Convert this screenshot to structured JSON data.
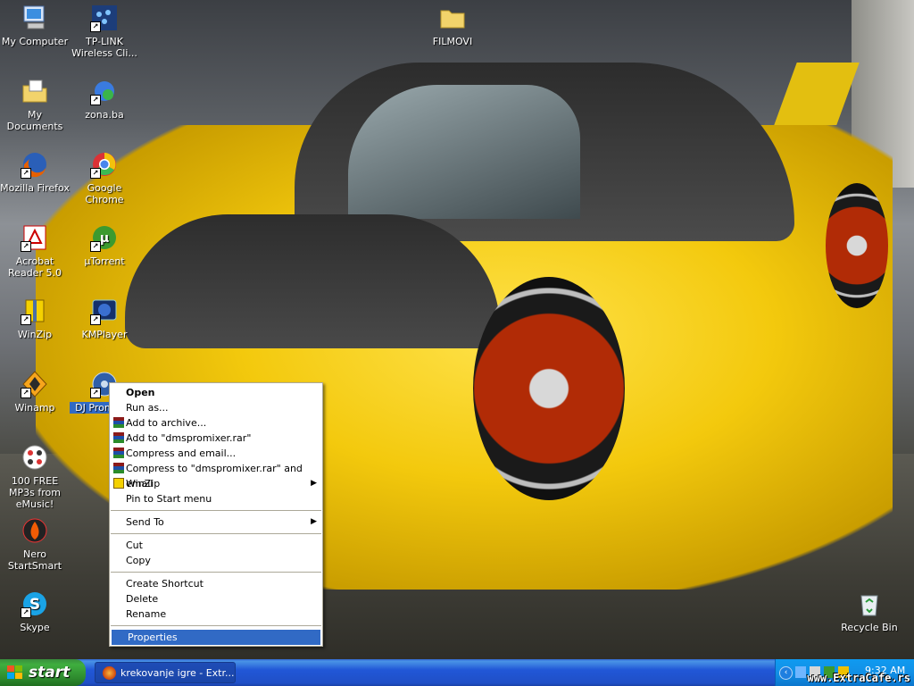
{
  "desktop": {
    "icons": [
      {
        "label": "My Computer"
      },
      {
        "label": "TP-LINK Wireless Cli..."
      },
      {
        "label": "FILMOVI"
      },
      {
        "label": "My Documents"
      },
      {
        "label": "zona.ba"
      },
      {
        "label": "Mozilla Firefox"
      },
      {
        "label": "Google Chrome"
      },
      {
        "label": "Acrobat Reader 5.0"
      },
      {
        "label": "µTorrent"
      },
      {
        "label": "WinZip"
      },
      {
        "label": "KMPlayer"
      },
      {
        "label": "Winamp"
      },
      {
        "label": "DJ Prom Full"
      },
      {
        "label": "100 FREE MP3s from eMusic!"
      },
      {
        "label": "Nero StartSmart"
      },
      {
        "label": "Skype"
      },
      {
        "label": "Recycle Bin"
      }
    ]
  },
  "context_menu": {
    "items": [
      {
        "label": "Open"
      },
      {
        "label": "Run as..."
      },
      {
        "label": "Add to archive..."
      },
      {
        "label": "Add to \"dmspromixer.rar\""
      },
      {
        "label": "Compress and email..."
      },
      {
        "label": "Compress to \"dmspromixer.rar\" and email"
      },
      {
        "label": "WinZip"
      },
      {
        "label": "Pin to Start menu"
      },
      {
        "label": "Send To"
      },
      {
        "label": "Cut"
      },
      {
        "label": "Copy"
      },
      {
        "label": "Create Shortcut"
      },
      {
        "label": "Delete"
      },
      {
        "label": "Rename"
      },
      {
        "label": "Properties"
      }
    ]
  },
  "taskbar": {
    "start_label": "start",
    "task_label": "krekovanje igre - Extr...",
    "clock": "9:32 AM"
  },
  "watermark": "www.ExtraCafe.rs",
  "colors": {
    "selection": "#316ac5",
    "taskbar_blue": "#2157d7",
    "start_green": "#3fae3f",
    "tray_blue": "#1290e6"
  }
}
